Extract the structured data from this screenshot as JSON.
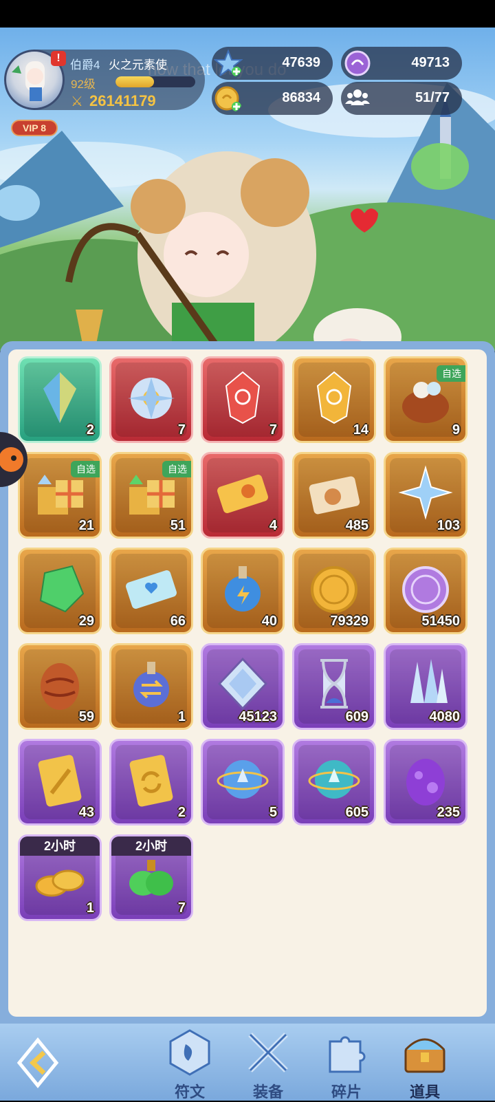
{
  "watermark": "now that let you do",
  "player": {
    "rank": "伯爵4",
    "name": "火之元素使",
    "level": "92级",
    "xp_fraction": 0.48,
    "power": "26141179",
    "vip": "VIP 8",
    "alert": "!"
  },
  "resources": [
    {
      "icon": "star-gem-icon",
      "value": "47639"
    },
    {
      "icon": "purple-coin-icon",
      "value": "49713"
    },
    {
      "icon": "gold-coin-icon",
      "value": "86834"
    },
    {
      "icon": "people-icon",
      "value": "51/77"
    }
  ],
  "items": [
    {
      "icon": "rainbow-crystal-icon",
      "rarity": "green",
      "count": "2"
    },
    {
      "icon": "crystal-flower-icon",
      "rarity": "red",
      "count": "7"
    },
    {
      "icon": "red-rune-stone-icon",
      "rarity": "red",
      "count": "7"
    },
    {
      "icon": "gold-rune-stone-icon",
      "rarity": "gold",
      "count": "14"
    },
    {
      "icon": "pet-nest-icon",
      "rarity": "gold",
      "count": "9",
      "tag": "自选"
    },
    {
      "icon": "gift-box-blue-icon",
      "rarity": "gold",
      "count": "21",
      "tag": "自选"
    },
    {
      "icon": "gift-box-green-icon",
      "rarity": "gold",
      "count": "51",
      "tag": "自选"
    },
    {
      "icon": "gold-ticket-icon",
      "rarity": "red",
      "count": "4"
    },
    {
      "icon": "summon-ticket-icon",
      "rarity": "gold",
      "count": "485"
    },
    {
      "icon": "blue-star-crystal-icon",
      "rarity": "gold",
      "count": "103"
    },
    {
      "icon": "green-ore-icon",
      "rarity": "gold",
      "count": "29"
    },
    {
      "icon": "heart-ticket-icon",
      "rarity": "gold",
      "count": "66"
    },
    {
      "icon": "energy-potion-icon",
      "rarity": "gold",
      "count": "40"
    },
    {
      "icon": "gold-medal-coin-icon",
      "rarity": "gold",
      "count": "79329"
    },
    {
      "icon": "purple-medal-coin-icon",
      "rarity": "gold",
      "count": "51450"
    },
    {
      "icon": "fire-egg-icon",
      "rarity": "gold",
      "count": "59"
    },
    {
      "icon": "swap-potion-icon",
      "rarity": "gold",
      "count": "1"
    },
    {
      "icon": "diamond-frame-icon",
      "rarity": "purple",
      "count": "45123"
    },
    {
      "icon": "hourglass-icon",
      "rarity": "purple",
      "count": "609"
    },
    {
      "icon": "ice-crystal-cluster-icon",
      "rarity": "purple",
      "count": "4080"
    },
    {
      "icon": "sword-card-icon",
      "rarity": "purple",
      "count": "43"
    },
    {
      "icon": "refresh-card-icon",
      "rarity": "purple",
      "count": "2"
    },
    {
      "icon": "blue-orb-icon",
      "rarity": "purple",
      "count": "5"
    },
    {
      "icon": "teal-orb-icon",
      "rarity": "purple",
      "count": "605"
    },
    {
      "icon": "purple-egg-icon",
      "rarity": "purple",
      "count": "235"
    },
    {
      "icon": "gold-coin-stack-icon",
      "rarity": "purple",
      "count": "1",
      "timer": "2小时"
    },
    {
      "icon": "green-potion-bag-icon",
      "rarity": "purple",
      "count": "7",
      "timer": "2小时"
    }
  ],
  "nav": [
    {
      "icon": "rune-icon",
      "label": "符文"
    },
    {
      "icon": "crossed-swords-icon",
      "label": "装备"
    },
    {
      "icon": "puzzle-piece-icon",
      "label": "碎片"
    },
    {
      "icon": "treasure-chest-icon",
      "label": "道具",
      "active": true
    }
  ]
}
